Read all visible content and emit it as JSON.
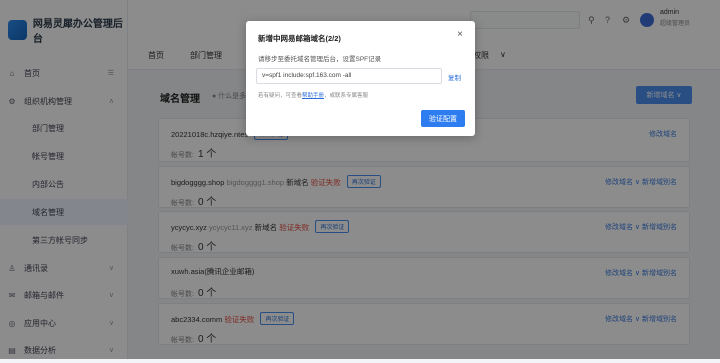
{
  "app": {
    "title": "网易灵犀办公管理后台"
  },
  "sidebar": {
    "items": [
      {
        "label": "首页",
        "icon": "home-icon"
      },
      {
        "label": "组织机构管理",
        "icon": "org-icon"
      },
      {
        "label": "部门管理"
      },
      {
        "label": "帐号管理"
      },
      {
        "label": "内部公告"
      },
      {
        "label": "域名管理"
      },
      {
        "label": "第三方帐号同步"
      },
      {
        "label": "通讯录",
        "icon": "contacts-icon"
      },
      {
        "label": "邮箱与邮件",
        "icon": "mail-icon"
      },
      {
        "label": "应用中心",
        "icon": "app-center-icon"
      },
      {
        "label": "数据分析",
        "icon": "analytics-icon"
      }
    ]
  },
  "header": {
    "user": {
      "name": "admin",
      "role": "超级管理员"
    }
  },
  "tabs": [
    {
      "label": "首页"
    },
    {
      "label": "部门管理"
    },
    {
      "label": "权限"
    }
  ],
  "page": {
    "title": "域名管理",
    "hint": "什么是多…",
    "add_domain_label": "新增域名",
    "count_label": "帐号数:",
    "domains": [
      {
        "name": "20221018c.hzqiye.ntes",
        "alias": "",
        "status": "",
        "verify": "再次验证",
        "count": "1 个",
        "actions": "修改域名"
      },
      {
        "name": "bigdogggg.shop",
        "alias": "bigdogggg1.shop",
        "tag": "新域名",
        "status": "验证失败",
        "verify": "再次验证",
        "count": "0 个",
        "actions": "修改域名 ∨  新增域别名"
      },
      {
        "name": "ycycyc.xyz",
        "alias": "ycycyc11.xyz",
        "tag": "新域名",
        "status": "验证失败",
        "verify": "再次验证",
        "count": "0 个",
        "actions": "修改域名 ∨  新增域别名"
      },
      {
        "name": "xuwh.asia(腾讯企业邮箱)",
        "alias": "",
        "tag": "",
        "status": "",
        "verify": "",
        "count": "0 个",
        "actions": "修改域名 ∨  新增域别名"
      },
      {
        "name": "abc2334.comm",
        "alias": "",
        "tag": "",
        "status": "验证失败",
        "verify": "再次验证",
        "count": "0 个",
        "actions": "修改域名 ∨  新增域别名"
      }
    ]
  },
  "modal": {
    "title": "新增中网易邮箱域名(2/2)",
    "description": "请移步至委托域名管理后台，设置SPF记录",
    "spf_value": "v=spf1 include:spf.163.com -all",
    "copy_label": "复制",
    "note_prefix": "若有疑问，可查看",
    "note_link": "帮助手册",
    "note_suffix": "，或联系专属客服",
    "confirm_label": "验证配置"
  }
}
